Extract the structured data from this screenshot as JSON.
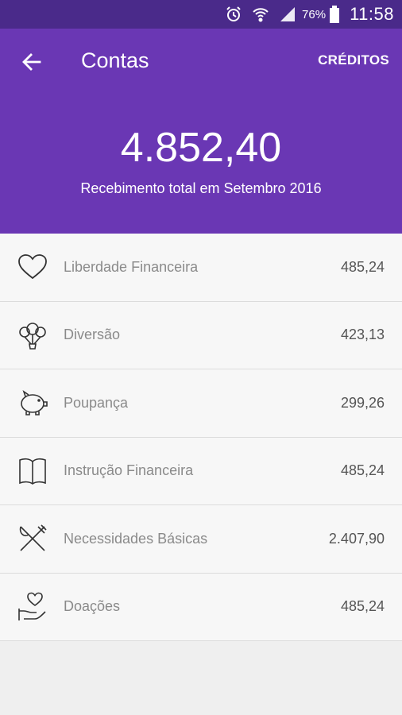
{
  "status_bar": {
    "battery_percent": "76%",
    "time": "11:58",
    "icons": [
      "alarm-icon",
      "wifi-icon",
      "signal-icon",
      "battery-icon"
    ]
  },
  "header": {
    "title": "Contas",
    "credits_label": "CRÉDITOS",
    "total": "4.852,40",
    "caption": "Recebimento total em Setembro 2016",
    "color": "#6a37b4"
  },
  "accounts": [
    {
      "label": "Liberdade Financeira",
      "value": "485,24",
      "icon": "heart-icon"
    },
    {
      "label": "Diversão",
      "value": "423,13",
      "icon": "balloons-icon"
    },
    {
      "label": "Poupança",
      "value": "299,26",
      "icon": "piggy-bank-icon"
    },
    {
      "label": "Instrução Financeira",
      "value": "485,24",
      "icon": "book-icon"
    },
    {
      "label": "Necessidades Básicas",
      "value": "2.407,90",
      "icon": "fork-knife-icon"
    },
    {
      "label": "Doações",
      "value": "485,24",
      "icon": "heart-hand-icon"
    }
  ]
}
